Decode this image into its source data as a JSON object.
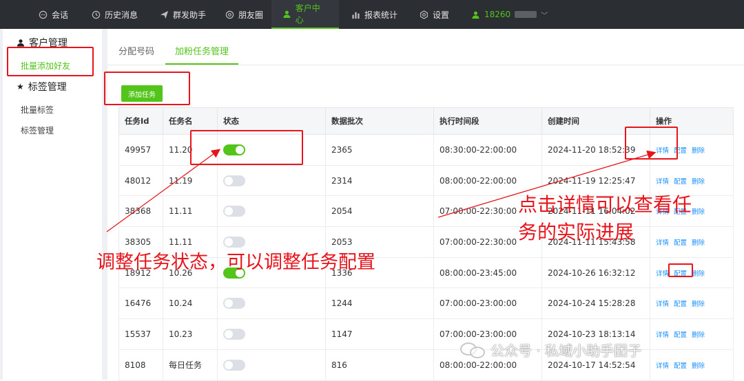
{
  "nav": {
    "items": [
      {
        "label": "会话",
        "icon": "chat-icon"
      },
      {
        "label": "历史消息",
        "icon": "clock-icon"
      },
      {
        "label": "群发助手",
        "icon": "send-icon"
      },
      {
        "label": "朋友圈",
        "icon": "aperture-icon"
      },
      {
        "label": "客户中心",
        "icon": "user-icon",
        "active": true
      },
      {
        "label": "报表统计",
        "icon": "bar-chart-icon"
      },
      {
        "label": "设置",
        "icon": "settings-icon"
      }
    ],
    "user_label": "18260",
    "accent": "#52c41a"
  },
  "sidebar": {
    "group1": "客户管理",
    "group1_item": "批量添加好友",
    "group2": "标签管理",
    "group2_items": [
      "批量标签",
      "标签管理"
    ]
  },
  "tabs": [
    "分配号码",
    "加粉任务管理"
  ],
  "add_button": "添加任务",
  "table": {
    "headers": [
      "任务Id",
      "任务名",
      "状态",
      "数据批次",
      "执行时间段",
      "创建时间",
      "操作"
    ],
    "rows": [
      {
        "id": "49957",
        "name": "11.20",
        "on": true,
        "batch": "2365",
        "period": "08:30:00-22:00:00",
        "created": "2024-11-20 18:52:39"
      },
      {
        "id": "48012",
        "name": "11.19",
        "on": false,
        "batch": "2314",
        "period": "08:00:00-22:00:00",
        "created": "2024-11-19 12:25:47"
      },
      {
        "id": "38368",
        "name": "11.11",
        "on": false,
        "batch": "2054",
        "period": "07:00:00-22:30:00",
        "created": "2024-11-11 16:04:02"
      },
      {
        "id": "38305",
        "name": "11.11",
        "on": false,
        "batch": "2053",
        "period": "07:00:00-22:30:00",
        "created": "2024-11-11 15:43:58"
      },
      {
        "id": "18912",
        "name": "10.26",
        "on": true,
        "batch": "1336",
        "period": "08:00:00-23:45:00",
        "created": "2024-10-26 16:32:12"
      },
      {
        "id": "16476",
        "name": "10.24",
        "on": false,
        "batch": "1244",
        "period": "07:00:00-23:00:00",
        "created": "2024-10-24 15:28:28"
      },
      {
        "id": "15537",
        "name": "10.23",
        "on": false,
        "batch": "1147",
        "period": "07:00:00-23:00:00",
        "created": "2024-10-23 18:13:14"
      },
      {
        "id": "8108",
        "name": "每日任务",
        "on": false,
        "batch": "816",
        "period": "08:00:00-22:00:00",
        "created": "2024-10-17 14:52:54"
      }
    ],
    "ops": [
      "详情",
      "配置",
      "删除"
    ]
  },
  "annotations": {
    "left_text": "调整任务状态，可以调整任务配置",
    "right_text_line1": "点击详情可以查看任",
    "right_text_line2": "务的实际进展",
    "color": "#e8141b"
  },
  "watermark": "公众号 · 私域小助手团子"
}
